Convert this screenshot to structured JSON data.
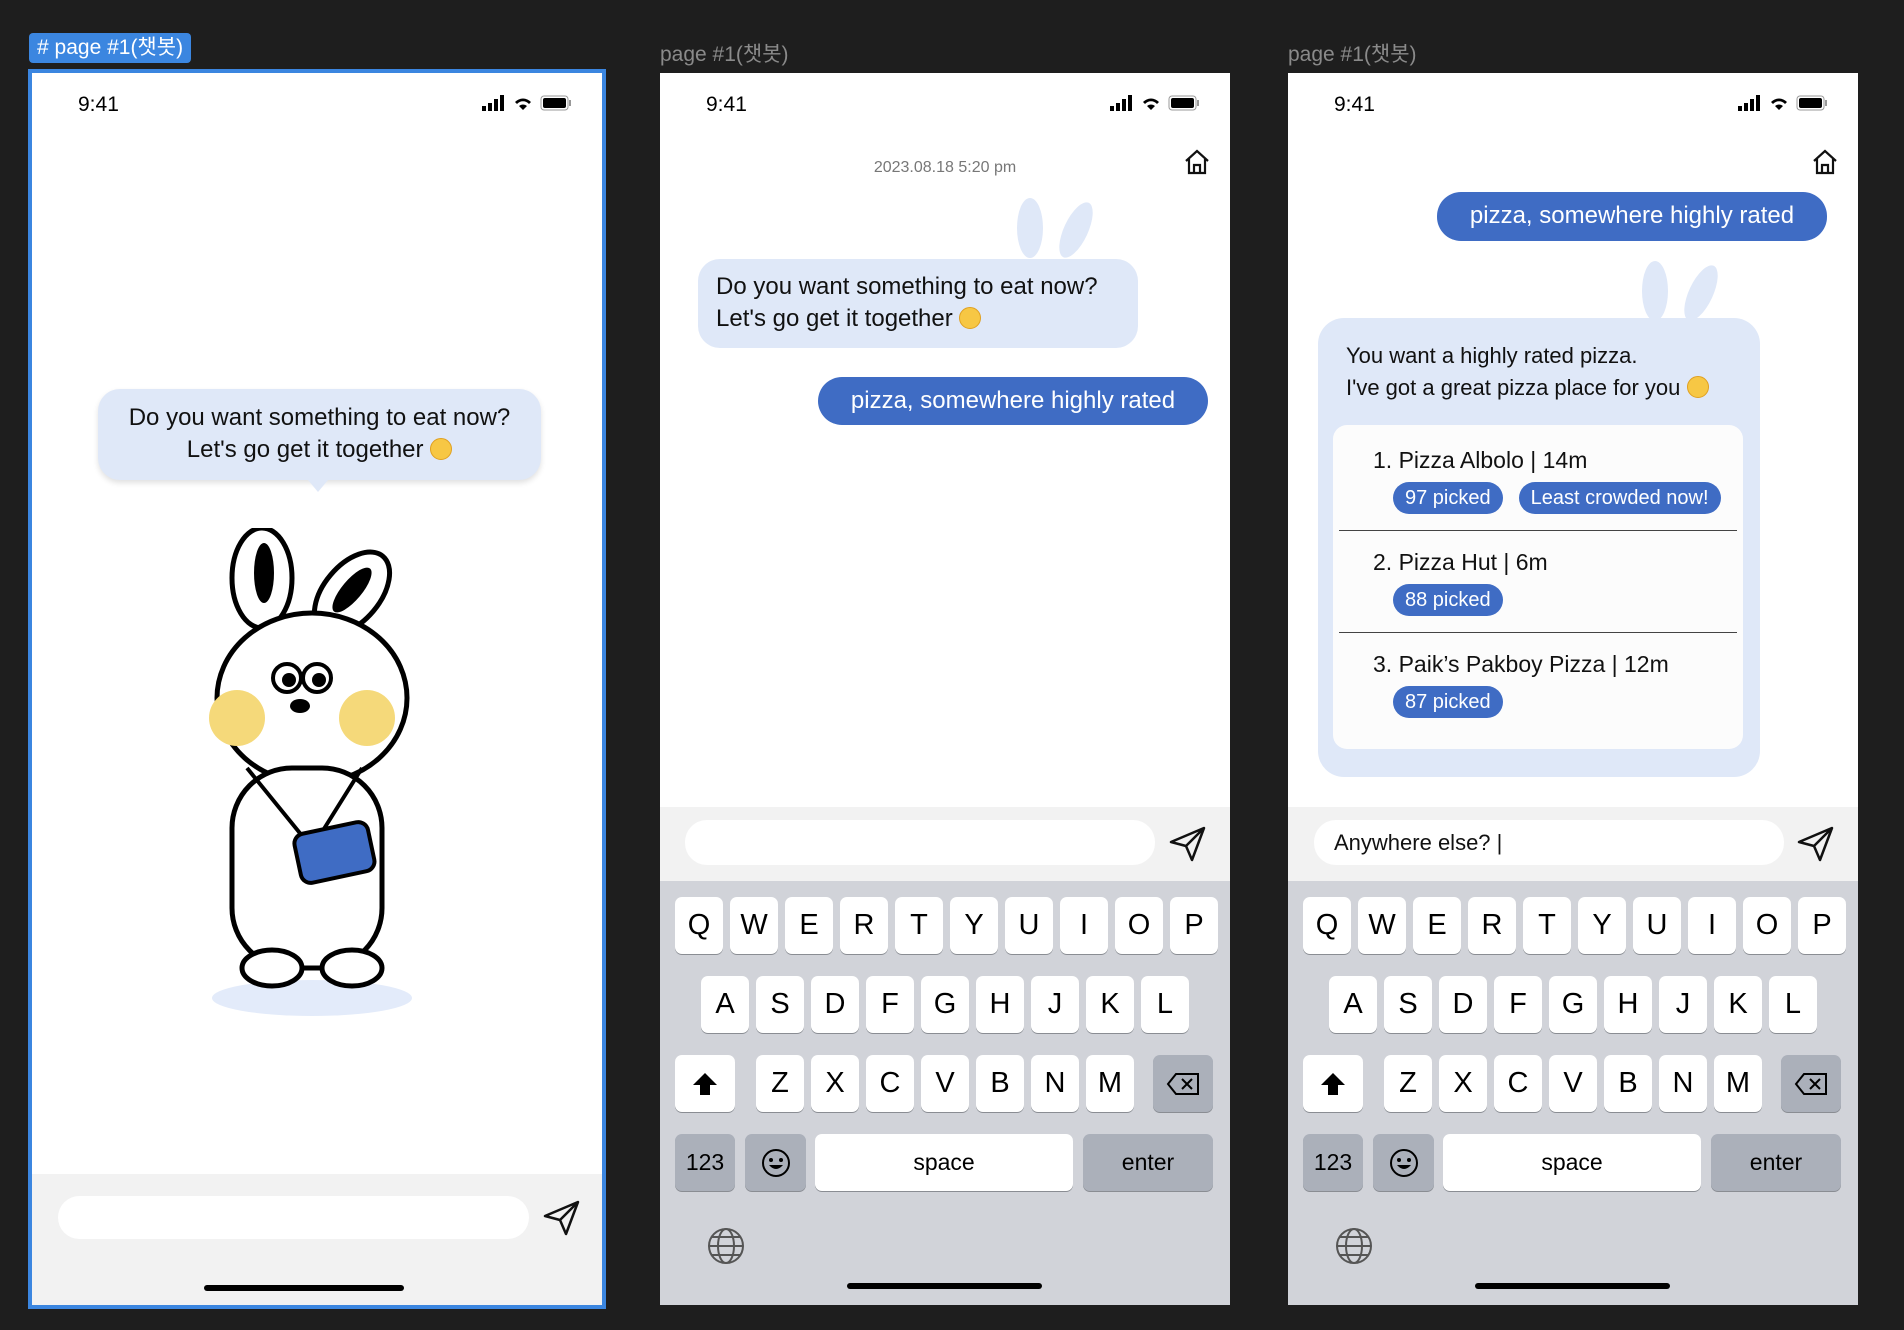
{
  "frames": [
    {
      "label": "page #1(챗봇)",
      "selected": true
    },
    {
      "label": "page #1(챗봇)",
      "selected": false
    },
    {
      "label": "page #1(챗봇)",
      "selected": false
    }
  ],
  "status": {
    "time": "9:41"
  },
  "phone1": {
    "bot_message": {
      "line1": "Do you want something to eat now?",
      "line2": "Let's go get it together",
      "emoji": "yum-emoji"
    },
    "input": {
      "value": ""
    }
  },
  "phone2": {
    "timestamp": "2023.08.18 5:20 pm",
    "bot_message": {
      "line1": "Do you want something to eat now?",
      "line2": "Let's go get it together"
    },
    "user_message": "pizza, somewhere highly rated",
    "input": {
      "value": ""
    }
  },
  "phone3": {
    "user_message": "pizza, somewhere highly rated",
    "bot_message": {
      "line1": "You want a highly rated pizza.",
      "line2": "I've got a great pizza place for you"
    },
    "results": [
      {
        "title": "1.  Pizza Albolo | 14m",
        "tags": [
          "97 picked",
          "Least crowded now!"
        ]
      },
      {
        "title": "2.  Pizza Hut | 6m",
        "tags": [
          "88 picked"
        ]
      },
      {
        "title": "3.  Paik’s Pakboy Pizza |  12m",
        "tags": [
          "87 picked"
        ]
      }
    ],
    "input": {
      "value": "Anywhere else? |"
    }
  },
  "keyboard": {
    "rows": [
      [
        "Q",
        "W",
        "E",
        "R",
        "T",
        "Y",
        "U",
        "I",
        "O",
        "P"
      ],
      [
        "A",
        "S",
        "D",
        "F",
        "G",
        "H",
        "J",
        "K",
        "L"
      ],
      [
        "Z",
        "X",
        "C",
        "V",
        "B",
        "N",
        "M"
      ]
    ],
    "numbers": "123",
    "space": "space",
    "enter": "enter"
  },
  "colors": {
    "accent": "#3f6cc4",
    "bot_bubble": "#dfe8f8",
    "selection": "#3b86e0",
    "keyboard_bg": "#d1d3d9"
  }
}
